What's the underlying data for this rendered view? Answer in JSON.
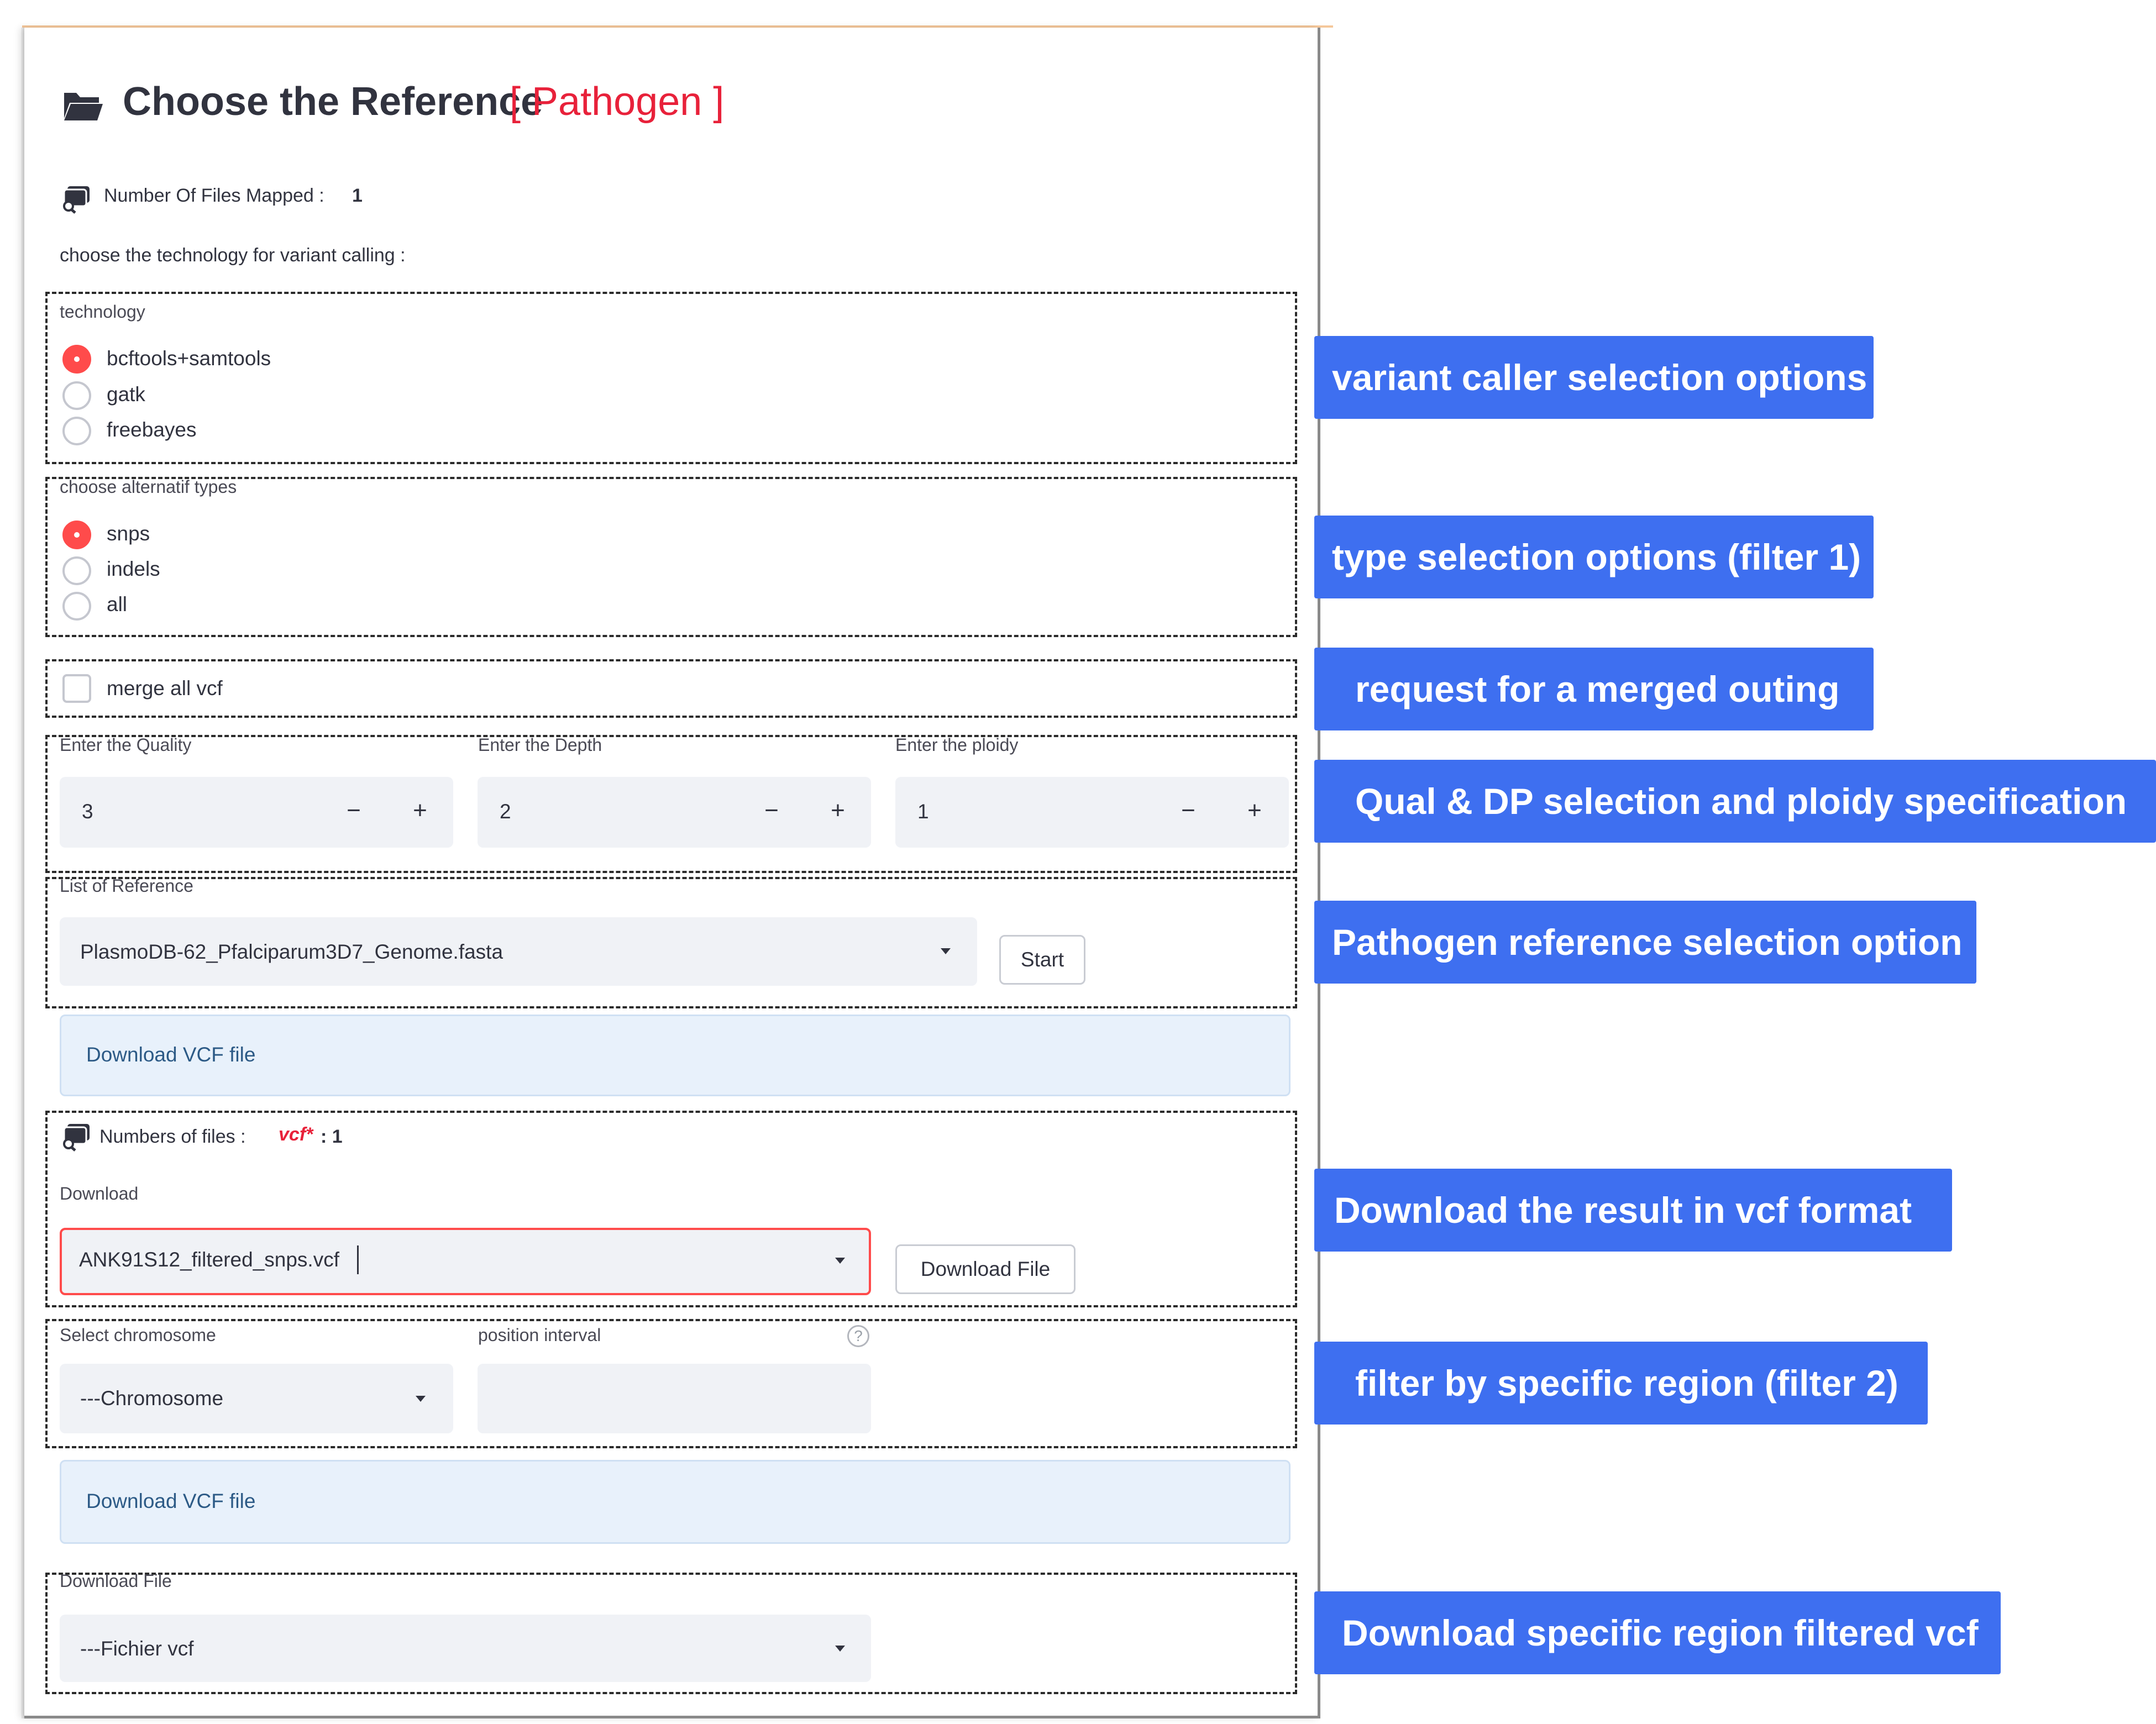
{
  "header": {
    "title": "Choose the Reference",
    "title_accent": "[ Pathogen ]",
    "folder_icon": "folder-open-icon"
  },
  "mapped_files": {
    "label": "Number Of Files Mapped :",
    "count": "1"
  },
  "technology_prompt": "choose the technology for variant calling :",
  "technology": {
    "label": "technology",
    "options": [
      "bcftools+samtools",
      "gatk",
      "freebayes"
    ],
    "selected": "bcftools+samtools"
  },
  "alt_types": {
    "label": "choose alternatif types",
    "options": [
      "snps",
      "indels",
      "all"
    ],
    "selected": "snps"
  },
  "merge": {
    "label": "merge all vcf",
    "checked": false
  },
  "numeric_inputs": {
    "quality": {
      "label": "Enter the Quality",
      "value": "3"
    },
    "depth": {
      "label": "Enter the Depth",
      "value": "2"
    },
    "ploidy": {
      "label": "Enter the ploidy",
      "value": "1"
    },
    "minus": "−",
    "plus": "+"
  },
  "reference": {
    "label": "List of Reference",
    "selected": "PlasmoDB-62_Pfalciparum3D7_Genome.fasta",
    "start_button": "Start"
  },
  "download_vcf_1": "Download VCF file",
  "files_section": {
    "label": "Numbers of files :",
    "vcf_label": "vcf*",
    "count": ": 1",
    "download_label": "Download",
    "selected_file": "ANK91S12_filtered_snps.vcf",
    "download_button": "Download File"
  },
  "region": {
    "chromosome_label": "Select chromosome",
    "chromosome_value": "---Chromosome",
    "interval_label": "position interval",
    "interval_value": "",
    "help": "?"
  },
  "download_vcf_2": "Download VCF file",
  "download_file": {
    "label": "Download File",
    "selected": "---Fichier vcf"
  },
  "annotations": [
    "variant caller selection options",
    "type selection options (filter 1)",
    "request for a merged outing",
    "Qual & DP selection and ploidy specification",
    "Pathogen reference selection option",
    "Download the result in vcf format",
    "filter by specific region (filter 2)",
    "Download specific region filtered vcf"
  ],
  "colors": {
    "accent_red": "#e8213a",
    "radio_selected": "#ff4b4b",
    "annotation_blue": "#3e6ff0",
    "download_link": "#2c5a86"
  }
}
